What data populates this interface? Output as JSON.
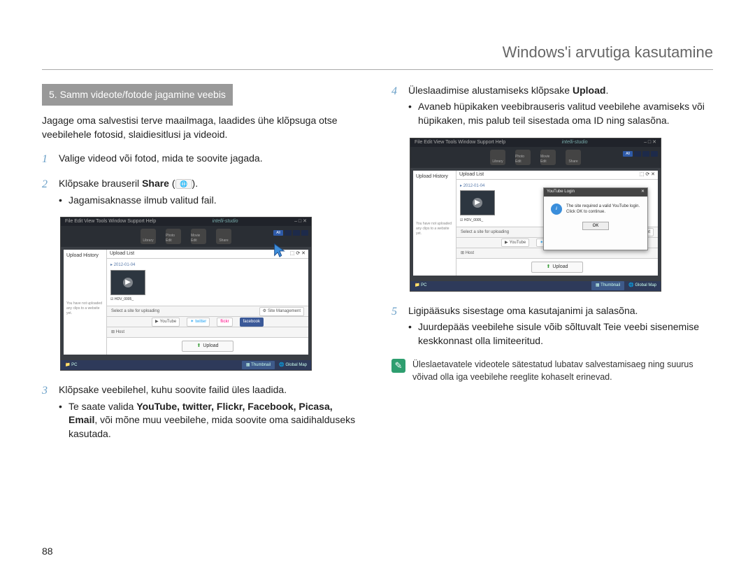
{
  "page": {
    "number": "88"
  },
  "header": {
    "title": "Windows'i arvutiga kasutamine"
  },
  "section": {
    "bar": "5. Samm videote/fotode jagamine veebis"
  },
  "intro": "Jagage oma salvestisi terve maailmaga, laadides ühe klõpsuga otse veebilehele fotosid, slaidiesitlusi ja videoid.",
  "steps": {
    "s1": {
      "num": "1",
      "text": "Valige videod või fotod, mida te soovite jagada."
    },
    "s2": {
      "num": "2",
      "text_a": "Klõpsake brauseril ",
      "text_bold": "Share",
      "text_b": " (",
      "text_c": ").",
      "sub": "Jagamisaknasse ilmub valitud fail."
    },
    "s3": {
      "num": "3",
      "text": "Klõpsake veebilehel, kuhu soovite failid üles laadida.",
      "sub_a": "Te saate valida ",
      "sub_bold": "YouTube, twitter, Flickr, Facebook, Picasa, Email",
      "sub_b": ", või mõne muu veebilehe, mida soovite oma saidihalduseks kasutada."
    },
    "s4": {
      "num": "4",
      "text_a": "Üleslaadimise alustamiseks klõpsake ",
      "text_bold": "Upload",
      "text_b": ".",
      "sub": "Avaneb hüpikaken veebibrauseris valitud veebilehe avamiseks või hüpikaken, mis palub teil sisestada oma ID ning salasõna."
    },
    "s5": {
      "num": "5",
      "text": "Ligipääsuks sisestage oma kasutajanimi ja salasõna.",
      "sub": "Juurdepääs veebilehe sisule võib sõltuvalt Teie veebi sisenemise keskkonnast olla limiteeritud."
    }
  },
  "note": {
    "icon_glyph": "✎",
    "text": "Üleslaetavatele videotele sätestatud lubatav salvestamisaeg ning suurus võivad olla iga veebilehe reeglite kohaselt erinevad."
  },
  "shot": {
    "brand": "intelli-studio",
    "menu": "File  Edit  View  Tools  Window  Support  Help",
    "tabs": {
      "library": "Library",
      "photoedit": "Photo Edit",
      "movieedit": "Movie Edit",
      "share": "Share"
    },
    "all": "All",
    "side_label": "Upload History",
    "side_note": "You have not uploaded any clips to a website yet.",
    "list_label": "Upload List",
    "date": "2012-01-04",
    "thumb_name": "HDV_0005_",
    "siterow_label": "Select a site for uploading",
    "sites": {
      "youtube": "YouTube",
      "twitter": "twitter",
      "flickr": "flickr",
      "facebook": "facebook"
    },
    "host_label": "Host",
    "site_mgmt": "Site Management",
    "upload_btn": "Upload",
    "footer_pc": "PC",
    "footer_thumb": "Thumbnail",
    "footer_map": "Global Map",
    "popup": {
      "title": "YouTube Login",
      "msg1": "The site required a valid YouTube login.",
      "msg2": "Click OK to continue.",
      "ok": "OK",
      "close": "✕"
    }
  }
}
